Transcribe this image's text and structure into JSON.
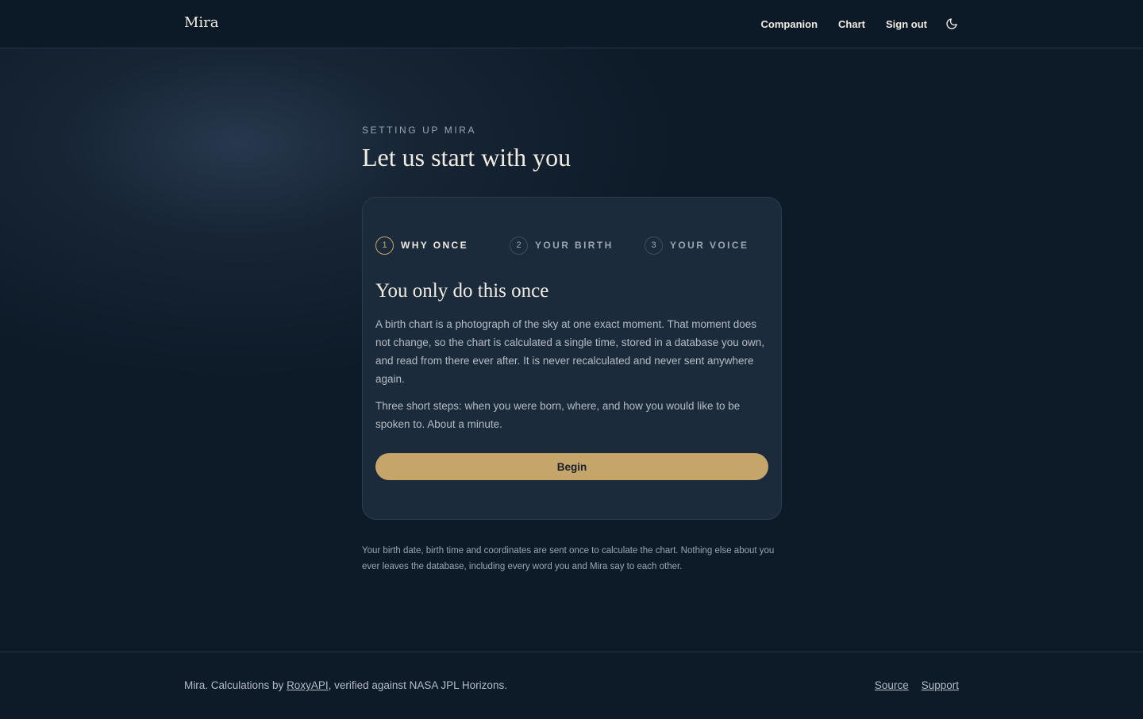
{
  "header": {
    "brand": "Mira",
    "nav": [
      {
        "label": "Companion"
      },
      {
        "label": "Chart"
      },
      {
        "label": "Sign out"
      }
    ],
    "theme_toggle_icon": "moon-icon"
  },
  "main": {
    "eyebrow": "SETTING UP MIRA",
    "title": "Let us start with you",
    "steps": [
      {
        "number": "1",
        "label": "WHY ONCE",
        "active": true
      },
      {
        "number": "2",
        "label": "YOUR BIRTH",
        "active": false
      },
      {
        "number": "3",
        "label": "YOUR VOICE",
        "active": false
      }
    ],
    "card": {
      "heading": "You only do this once",
      "paragraph1": "A birth chart is a photograph of the sky at one exact moment. That moment does not change, so the chart is calculated a single time, stored in a database you own, and read from there ever after. It is never recalculated and never sent anywhere again.",
      "paragraph2": "Three short steps: when you were born, where, and how you would like to be spoken to. About a minute.",
      "button_label": "Begin"
    },
    "privacy_note": "Your birth date, birth time and coordinates are sent once to calculate the chart. Nothing else about you ever leaves the database, including every word you and Mira say to each other."
  },
  "footer": {
    "text_prefix": "Mira. Calculations by ",
    "link_roxy": "RoxyAPI",
    "text_suffix": ", verified against NASA JPL Horizons.",
    "links": [
      {
        "label": "Source"
      },
      {
        "label": "Support"
      }
    ]
  },
  "colors": {
    "background": "#0d1a28",
    "card": "#1c2b3c",
    "accent_gold": "#c6a56a",
    "text_primary": "#f1ece2",
    "text_muted": "#9aa6b3"
  }
}
